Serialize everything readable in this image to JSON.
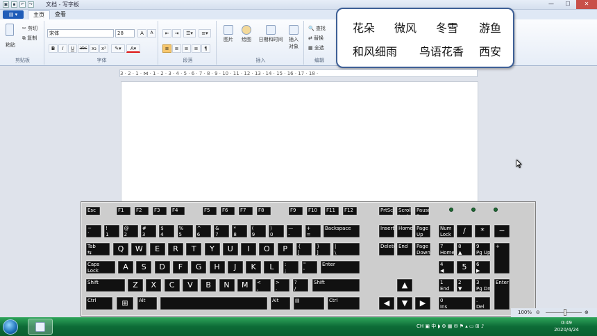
{
  "window": {
    "title": "文档 - 写字板",
    "minimize": "—",
    "maximize": "☐",
    "close": "✕"
  },
  "tabs": {
    "file": "▤ ▾",
    "home": "主页",
    "view": "查看"
  },
  "ribbon": {
    "clipboard": {
      "label": "剪贴板",
      "paste": "粘贴",
      "cut": "剪切",
      "copy": "复制"
    },
    "font": {
      "label": "字体",
      "family": "宋体",
      "size": "28",
      "grow": "A",
      "shrink": "A",
      "bold": "B",
      "italic": "I",
      "underline": "U",
      "strike": "abc",
      "sub": "x₂",
      "sup": "x²"
    },
    "paragraph": {
      "label": "段落"
    },
    "insert": {
      "label": "插入",
      "picture": "图片",
      "paint": "绘图",
      "datetime": "日期和时间",
      "object": "插入\n对象"
    },
    "edit": {
      "label": "编辑",
      "find": "查找",
      "replace": "替换",
      "selectall": "全选"
    }
  },
  "popup": {
    "words": [
      "花朵",
      "微风",
      "冬雪",
      "游鱼",
      "和风细雨",
      "鸟语花香",
      "西安"
    ]
  },
  "ruler": {
    "text": "3 · 2 · 1 · ⋈ · 1 · 2 · 3 · 4 · 5 · 6 · 7 · 8 · 9 · 10 · 11 · 12 · 13 · 14 · 15 · 16 · 17 · 18 ·"
  },
  "status": {
    "zoom": "100%"
  },
  "clock": {
    "time": "0:49",
    "date": "2020/4/24"
  },
  "keyboard": {
    "esc": "Esc",
    "f": [
      "F1",
      "F2",
      "F3",
      "F4",
      "F5",
      "F6",
      "F7",
      "F8",
      "F9",
      "F10",
      "F11",
      "F12"
    ],
    "sys": [
      "PrtSc",
      "Scroll\nLock",
      "Pause\nBreak"
    ],
    "row1": [
      "~\n`",
      "!\n1",
      "@\n2",
      "#\n3",
      "$\n4",
      "%\n5",
      "^\n6",
      "&\n7",
      "*\n8",
      "(\n9",
      ")\n0",
      "—\n-",
      "+\n=",
      "Backspace"
    ],
    "row2": [
      "Tab\n⇆",
      "Q",
      "W",
      "E",
      "R",
      "T",
      "Y",
      "U",
      "I",
      "O",
      "P",
      "{\n[",
      "}\n]",
      "|\n\\"
    ],
    "row3": [
      "Caps\nLock",
      "A",
      "S",
      "D",
      "F",
      "G",
      "H",
      "J",
      "K",
      "L",
      ":\n;",
      "\"\n'",
      "Enter"
    ],
    "row4": [
      "Shift",
      "Z",
      "X",
      "C",
      "V",
      "B",
      "N",
      "M",
      "<\n,",
      ">\n.",
      "?\n/",
      "Shift"
    ],
    "row5": [
      "Ctrl",
      "⊞",
      "Alt",
      "",
      "Alt",
      "▤",
      "Ctrl"
    ],
    "nav1": [
      "Insert",
      "Home",
      "Page\nUp"
    ],
    "nav2": [
      "Delete",
      "End",
      "Page\nDown"
    ],
    "arrows": [
      "▲",
      "◀",
      "▼",
      "▶"
    ],
    "num": [
      "Num\nLock",
      "/",
      "*",
      "−",
      "7\nHome",
      "8\n▲",
      "9\nPg Up",
      "+",
      "4\n◀",
      "5",
      "6\n▶",
      "1\nEnd",
      "2\n▼",
      "3\nPg Dn",
      "Enter",
      "0\nIns",
      ".\nDel"
    ]
  }
}
